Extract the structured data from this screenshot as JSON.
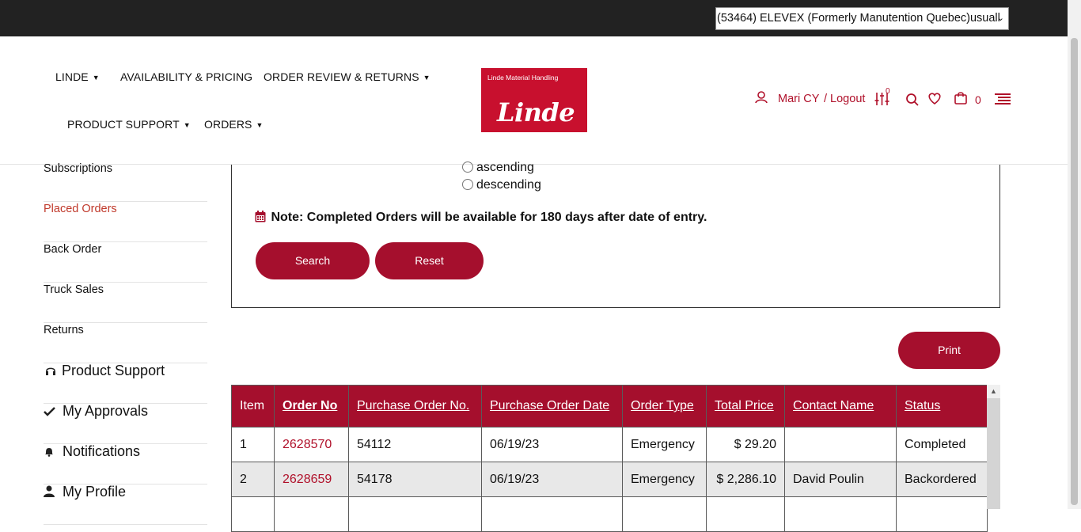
{
  "account": {
    "selected": "(53464) ELEVEX (Formerly Manutention Quebec)usuall"
  },
  "nav": {
    "linde": "LINDE",
    "availability": "AVAILABILITY & PRICING",
    "order_review": "ORDER REVIEW & RETURNS",
    "product_support": "PRODUCT SUPPORT",
    "orders": "ORDERS"
  },
  "logo": {
    "tagline": "Linde Material Handling",
    "wordmark": "Linde"
  },
  "header_right": {
    "user": "Mari CY",
    "logout": "/ Logout",
    "compare_count": "0",
    "cart_count": "0"
  },
  "sidebar": {
    "items": [
      {
        "label": "Subscriptions"
      },
      {
        "label": "Placed Orders"
      },
      {
        "label": "Back Order"
      },
      {
        "label": "Truck Sales"
      },
      {
        "label": "Returns"
      },
      {
        "label": "Product Support"
      },
      {
        "label": "My Approvals"
      },
      {
        "label": "Notifications"
      },
      {
        "label": "My Profile"
      }
    ]
  },
  "search": {
    "sort_ascending": "ascending",
    "sort_descending": "descending",
    "note": "Note: Completed Orders will be available for 180 days after date of entry.",
    "search_label": "Search",
    "reset_label": "Reset",
    "print_label": "Print"
  },
  "table": {
    "headers": [
      "Item",
      "Order No",
      "Purchase Order No.",
      "Purchase Order Date",
      "Order Type",
      "Total Price",
      "Contact Name",
      "Status"
    ],
    "rows": [
      [
        "1",
        "2628570",
        "54112",
        "06/19/23",
        "Emergency",
        "$ 29.20",
        "",
        "Completed"
      ],
      [
        "2",
        "2628659",
        "54178",
        "06/19/23",
        "Emergency",
        "$ 2,286.10",
        "David Poulin",
        "Backordered"
      ]
    ]
  },
  "colors": {
    "brand_red": "#a50f2d",
    "link_red": "#b0102a",
    "topbar": "#222222"
  }
}
